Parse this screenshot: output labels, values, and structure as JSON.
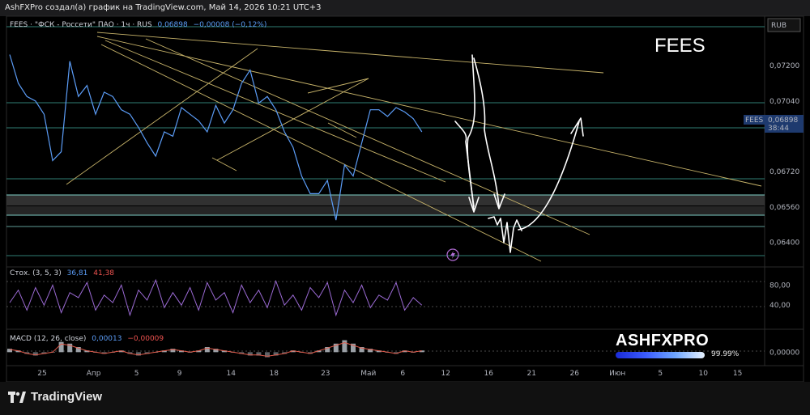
{
  "header": {
    "attribution": "AshFXPro создал(а) график на TradingView.com, Май 14, 2026 10:21 UTC+3"
  },
  "chart_data": {
    "type": "line",
    "symbol_label": "FEES",
    "legend": {
      "name": "FEES · \"ФСК - Россети\" ПАО · 1ч · RUS",
      "price": "0,06898",
      "change": "−0,00008 (−0,12%)"
    },
    "currency": "RUB",
    "price_badge": {
      "symbol": "FEES",
      "price": "0,06898",
      "countdown": "38:44"
    },
    "price_ticks": [
      "0,07200",
      "0,07040",
      "0,06720",
      "0,06560",
      "0,06400"
    ],
    "price_tick_values": [
      0.072,
      0.0704,
      0.0672,
      0.0656,
      0.064
    ],
    "ylim": [
      0.0631,
      0.0738
    ],
    "x_tick_labels": [
      "25",
      "Апр",
      "5",
      "9",
      "14",
      "18",
      "23",
      "Май",
      "6",
      "12",
      "16",
      "21",
      "26",
      "Июн",
      "5",
      "10",
      "15"
    ],
    "x_tick_index": [
      0,
      6,
      11,
      16,
      22,
      27,
      33,
      38,
      42,
      47,
      52,
      57,
      62,
      67,
      72,
      77,
      81
    ],
    "price_series_x": [
      0,
      1,
      2,
      3,
      4,
      5,
      6,
      7,
      8,
      9,
      10,
      11,
      12,
      13,
      14,
      15,
      16,
      17,
      18,
      19,
      20,
      21,
      22,
      23,
      24,
      25,
      26,
      27,
      28,
      29,
      30,
      31,
      32,
      33,
      34,
      35,
      36,
      37,
      38,
      39,
      40,
      41,
      42,
      43,
      44,
      45,
      46,
      47,
      48
    ],
    "price_series": [
      0.0725,
      0.0712,
      0.0706,
      0.0704,
      0.0698,
      0.0677,
      0.0681,
      0.0722,
      0.0706,
      0.0711,
      0.0698,
      0.0708,
      0.0706,
      0.07,
      0.0698,
      0.0692,
      0.0685,
      0.0679,
      0.069,
      0.0688,
      0.0701,
      0.0698,
      0.0695,
      0.069,
      0.0702,
      0.0694,
      0.07,
      0.0712,
      0.0718,
      0.0703,
      0.0706,
      0.07,
      0.069,
      0.0683,
      0.067,
      0.0662,
      0.0662,
      0.0668,
      0.065,
      0.0675,
      0.067,
      0.0685,
      0.07,
      0.07,
      0.0697,
      0.0701,
      0.0699,
      0.0696,
      0.069
    ],
    "stochastic": {
      "label": "Стох. (3, 5, 3)",
      "k": "36,81",
      "d": "41,38",
      "ticks": [
        "80,00",
        "40,00"
      ],
      "tick_values": [
        80,
        40
      ],
      "ylim": [
        0,
        100
      ],
      "values": [
        45,
        70,
        30,
        75,
        40,
        80,
        25,
        65,
        55,
        85,
        30,
        60,
        45,
        80,
        20,
        70,
        50,
        90,
        35,
        65,
        40,
        75,
        30,
        85,
        50,
        65,
        25,
        80,
        45,
        70,
        35,
        88,
        40,
        60,
        30,
        75,
        55,
        85,
        20,
        70,
        45,
        80,
        35,
        60,
        50,
        85,
        30,
        55,
        40
      ]
    },
    "macd": {
      "label": "MACD (12, 26, close)",
      "macd": "0,00013",
      "signal": "−0,00009",
      "ticks": [
        "0,00000"
      ],
      "tick_values": [
        0
      ],
      "ylim": [
        -0.0006,
        0.0012
      ],
      "values": [
        0.0002,
        0.0001,
        -0.0001,
        -0.0002,
        -0.0001,
        0.0,
        0.0006,
        0.0005,
        0.0003,
        0.0001,
        0.0,
        -0.0001,
        0.0,
        0.0001,
        -0.0001,
        -0.0002,
        -0.0001,
        0.0,
        0.0001,
        0.0002,
        0.0001,
        0.0,
        0.0001,
        0.0003,
        0.0002,
        0.0001,
        0.0,
        -0.0001,
        -0.0002,
        -0.0002,
        -0.0003,
        -0.0002,
        -0.0001,
        0.0001,
        0.0,
        -0.0001,
        0.0001,
        0.0003,
        0.0005,
        0.0007,
        0.0005,
        0.0003,
        0.0002,
        0.0001,
        0.0,
        -0.0001,
        0.0001,
        0.0,
        0.0001
      ]
    },
    "annotation_title": "FEES"
  },
  "watermark": {
    "brand": "ASHFXPRO",
    "progress_text": "99.99%",
    "progress_value": 0.9999
  },
  "footer": {
    "logo_text": "TradingView"
  },
  "colors": {
    "price_line": "#5b9cf6",
    "trend_lines": "#c8b46a",
    "stoch_line": "#9b6ad4",
    "drawings": "#ffffff",
    "background": "#000000"
  }
}
